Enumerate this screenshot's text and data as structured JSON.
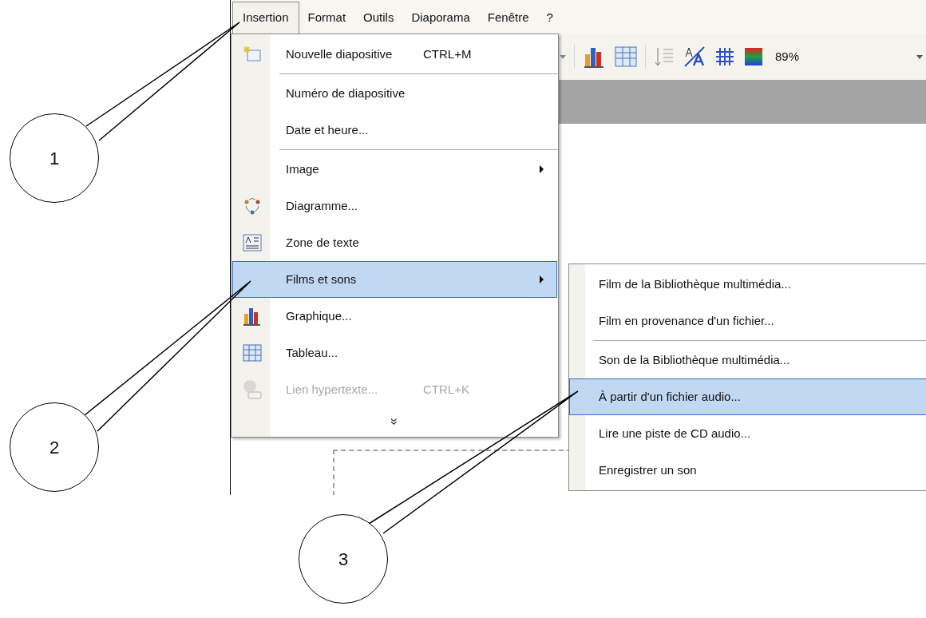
{
  "menu_bar": [
    {
      "label": "Insertion",
      "selected": true
    },
    {
      "label": "Format",
      "selected": false
    },
    {
      "label": "Outils",
      "selected": false
    },
    {
      "label": "Diaporama",
      "selected": false
    },
    {
      "label": "Fenêtre",
      "selected": false
    },
    {
      "label": "?",
      "selected": false
    }
  ],
  "toolbar": {
    "zoom": "89%"
  },
  "menu": {
    "items": [
      {
        "kind": "item",
        "label": "Nouvelle diapositive",
        "shortcut": "CTRL+M",
        "selected": false,
        "disabled": false,
        "submenu": false
      },
      {
        "kind": "separator"
      },
      {
        "kind": "item",
        "label": "Numéro de diapositive",
        "selected": false,
        "disabled": false,
        "submenu": false
      },
      {
        "kind": "item",
        "label": "Date et heure...",
        "selected": false,
        "disabled": false,
        "submenu": false
      },
      {
        "kind": "separator"
      },
      {
        "kind": "item",
        "label": "Image",
        "selected": false,
        "disabled": false,
        "submenu": true
      },
      {
        "kind": "item",
        "label": "Diagramme...",
        "selected": false,
        "disabled": false,
        "submenu": false
      },
      {
        "kind": "item",
        "label": "Zone de texte",
        "selected": false,
        "disabled": false,
        "submenu": false
      },
      {
        "kind": "item",
        "label": "Films et sons",
        "selected": true,
        "disabled": false,
        "submenu": true
      },
      {
        "kind": "item",
        "label": "Graphique...",
        "selected": false,
        "disabled": false,
        "submenu": false
      },
      {
        "kind": "item",
        "label": "Tableau...",
        "selected": false,
        "disabled": false,
        "submenu": false
      },
      {
        "kind": "item",
        "label": "Lien hypertexte...",
        "shortcut": "CTRL+K",
        "selected": false,
        "disabled": true,
        "submenu": false
      },
      {
        "kind": "more",
        "label": "»"
      }
    ]
  },
  "submenu": {
    "items": [
      {
        "kind": "item",
        "label": "Film de la Bibliothèque multimédia...",
        "selected": false
      },
      {
        "kind": "item",
        "label": "Film en provenance d'un fichier...",
        "selected": false
      },
      {
        "kind": "separator"
      },
      {
        "kind": "item",
        "label": "Son de la Bibliothèque multimédia...",
        "selected": false
      },
      {
        "kind": "item",
        "label": "À partir d'un fichier audio...",
        "selected": true
      },
      {
        "kind": "item",
        "label": "Lire une piste de CD audio...",
        "selected": false
      },
      {
        "kind": "item",
        "label": "Enregistrer un son",
        "selected": false
      }
    ]
  },
  "callouts": [
    "1",
    "2",
    "3"
  ]
}
